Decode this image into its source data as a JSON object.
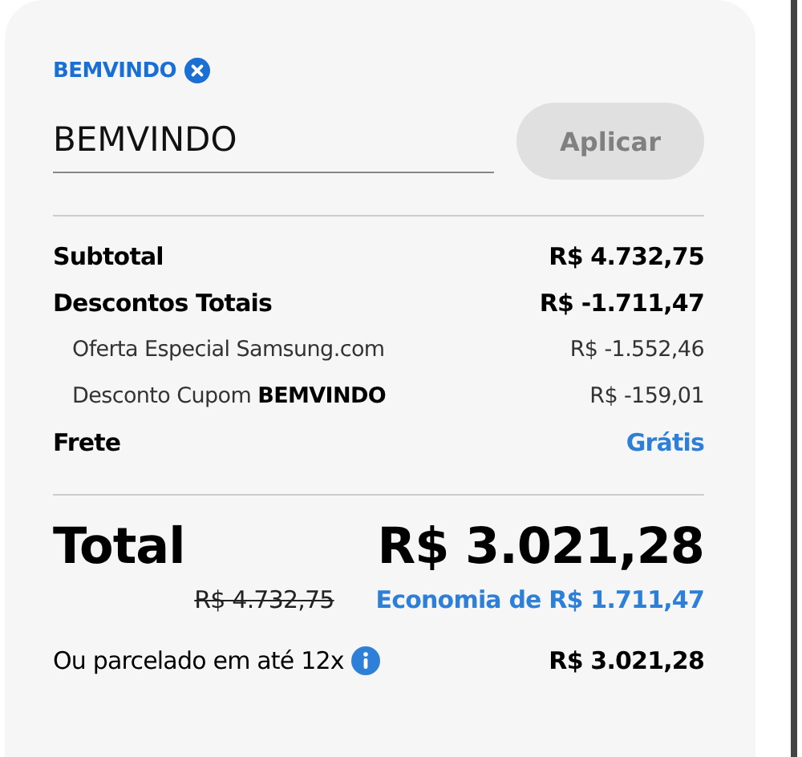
{
  "coupon_tag": {
    "code": "BEMVINDO"
  },
  "coupon_field": {
    "value": "BEMVINDO"
  },
  "apply_button": {
    "label": "Aplicar",
    "disabled": true
  },
  "summary_rows": [
    {
      "kind": "main",
      "label": "Subtotal",
      "value": "R$ 4.732,75"
    },
    {
      "kind": "main",
      "label": "Descontos Totais",
      "value": "R$ -1.711,47"
    },
    {
      "kind": "sub",
      "label": "Oferta Especial Samsung.com",
      "value": "R$ -1.552,46"
    },
    {
      "kind": "sub",
      "label": "Desconto Cupom **BEMVINDO**",
      "value": "R$ -159,01"
    },
    {
      "kind": "highlight",
      "label": "Frete",
      "value": "Grátis"
    }
  ],
  "total": {
    "label": "Total",
    "value": "R$ 3.021,28",
    "old_price": "R$ 4.732,75",
    "savings": "Economia de R$ 1.711,47"
  },
  "installments": {
    "label": "Ou parcelado em até 12x",
    "value": "R$ 3.021,28"
  }
}
